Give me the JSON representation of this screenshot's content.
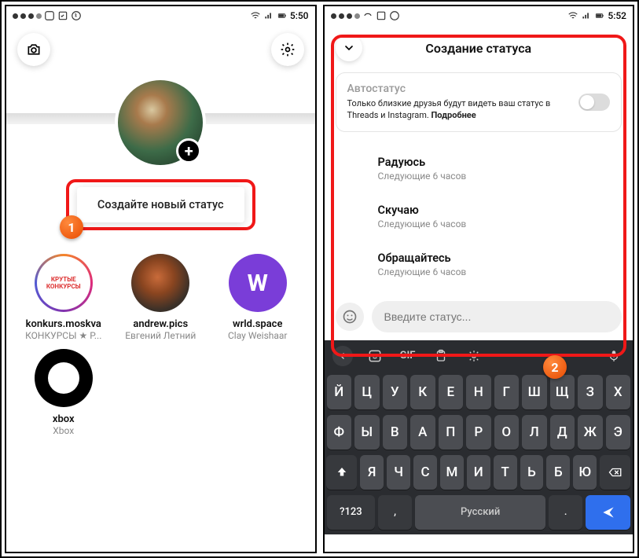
{
  "left": {
    "status_bar": {
      "time": "5:50"
    },
    "create_status": "Создайте новый статус",
    "friends": [
      {
        "name": "konkurs.moskva",
        "sub": "КОНКУРСЫ ★ Р..."
      },
      {
        "name": "andrew.pics",
        "sub": "Евгений Летний"
      },
      {
        "name": "wrld.space",
        "sub": "Clay Weishaar"
      },
      {
        "name": "xbox",
        "sub": "Xbox"
      }
    ]
  },
  "right": {
    "status_bar": {
      "time": "5:52"
    },
    "title": "Создание статуса",
    "auto_card": {
      "title": "Автостатус",
      "desc": "Только близкие друзья будут видеть ваш статус в Threads и Instagram.",
      "more": "Подробнее"
    },
    "statuses": [
      {
        "title": "Радуюсь",
        "sub": "Следующие 6 часов"
      },
      {
        "title": "Скучаю",
        "sub": "Следующие 6 часов"
      },
      {
        "title": "Обращайтесь",
        "sub": "Следующие 6 часов"
      }
    ],
    "input_placeholder": "Введите статус...",
    "keyboard": {
      "gif": "GIF",
      "row1": [
        "Й",
        "Ц",
        "У",
        "К",
        "Е",
        "Н",
        "Г",
        "Ш",
        "Щ",
        "З",
        "Х"
      ],
      "row2": [
        "Ф",
        "Ы",
        "В",
        "А",
        "П",
        "Р",
        "О",
        "Л",
        "Д",
        "Ж",
        "Э"
      ],
      "row3": [
        "Я",
        "Ч",
        "С",
        "М",
        "И",
        "Т",
        "Ь",
        "Б",
        "Ю"
      ],
      "sym": "?123",
      "comma": ",",
      "space": "Русский",
      "period": "."
    }
  },
  "badges": {
    "one": "1",
    "two": "2"
  }
}
